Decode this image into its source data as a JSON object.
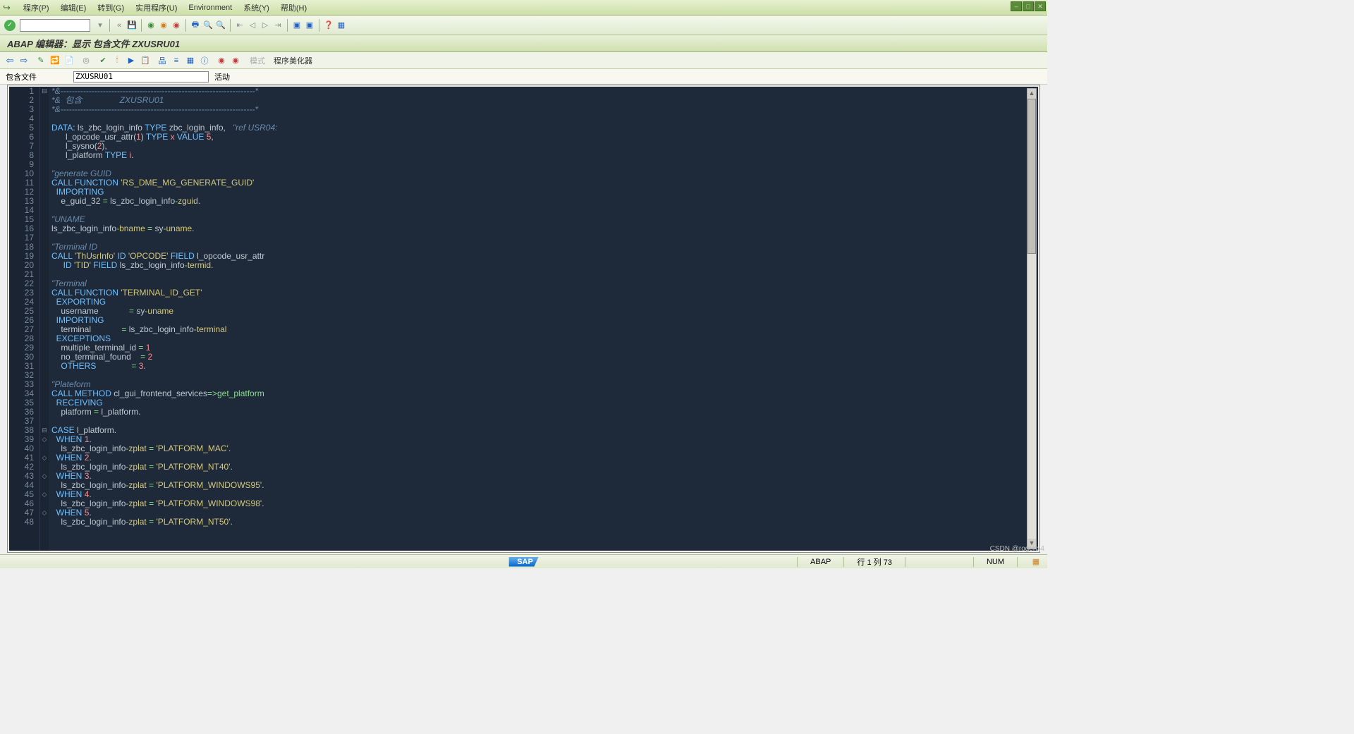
{
  "menubar": {
    "items": [
      "程序(P)",
      "编辑(E)",
      "转到(G)",
      "实用程序(U)",
      "Environment",
      "系统(Y)",
      "帮助(H)"
    ]
  },
  "title": "ABAP 编辑器：显示 包含文件 ZXUSRU01",
  "subtoolbar": {
    "mode_label": "模式",
    "beautify_label": "程序美化器"
  },
  "include": {
    "label": "包含文件",
    "value": "ZXUSRU01",
    "status": "活动"
  },
  "editor": {
    "line_count": 48,
    "fold_markers": {
      "1": "⊟",
      "38": "⊟",
      "39": "◇",
      "41": "◇",
      "43": "◇",
      "45": "◇",
      "47": "◇"
    },
    "lines": [
      [
        [
          "c-comment",
          "*&---------------------------------------------------------------------*"
        ]
      ],
      [
        [
          "c-comment",
          "*&  包含                ZXUSRU01"
        ]
      ],
      [
        [
          "c-comment",
          "*&---------------------------------------------------------------------*"
        ]
      ],
      [],
      [
        [
          "c-key",
          "DATA"
        ],
        [
          "c-plain",
          ": ls_zbc_login_info "
        ],
        [
          "c-key",
          "TYPE"
        ],
        [
          "c-plain",
          " zbc_login_info,   "
        ],
        [
          "c-comment",
          "\"ref USR04:"
        ]
      ],
      [
        [
          "c-plain",
          "      l_opcode_usr_attr("
        ],
        [
          "c-num",
          "1"
        ],
        [
          "c-plain",
          ") "
        ],
        [
          "c-key",
          "TYPE"
        ],
        [
          "c-plain",
          " "
        ],
        [
          "c-type",
          "x"
        ],
        [
          "c-plain",
          " "
        ],
        [
          "c-key",
          "VALUE"
        ],
        [
          "c-plain",
          " "
        ],
        [
          "c-num",
          "5"
        ],
        [
          "c-plain",
          ","
        ]
      ],
      [
        [
          "c-plain",
          "      l_sysno("
        ],
        [
          "c-num",
          "2"
        ],
        [
          "c-plain",
          "),"
        ]
      ],
      [
        [
          "c-plain",
          "      l_platform "
        ],
        [
          "c-key",
          "TYPE"
        ],
        [
          "c-plain",
          " "
        ],
        [
          "c-type",
          "i"
        ],
        [
          "c-plain",
          "."
        ]
      ],
      [],
      [
        [
          "c-comment",
          "\"generate GUID"
        ]
      ],
      [
        [
          "c-key",
          "CALL FUNCTION"
        ],
        [
          "c-plain",
          " "
        ],
        [
          "c-str",
          "'RS_DME_MG_GENERATE_GUID'"
        ]
      ],
      [
        [
          "c-plain",
          "  "
        ],
        [
          "c-key",
          "IMPORTING"
        ]
      ],
      [
        [
          "c-plain",
          "    e_guid_32 "
        ],
        [
          "c-op",
          "="
        ],
        [
          "c-plain",
          " ls_zbc_login_info"
        ],
        [
          "c-op",
          "-"
        ],
        [
          "c-field",
          "zguid"
        ],
        [
          "c-plain",
          "."
        ]
      ],
      [],
      [
        [
          "c-comment",
          "\"UNAME"
        ]
      ],
      [
        [
          "c-plain",
          "ls_zbc_login_info"
        ],
        [
          "c-op",
          "-"
        ],
        [
          "c-field",
          "bname"
        ],
        [
          "c-plain",
          " "
        ],
        [
          "c-op",
          "="
        ],
        [
          "c-plain",
          " sy"
        ],
        [
          "c-op",
          "-"
        ],
        [
          "c-field",
          "uname"
        ],
        [
          "c-plain",
          "."
        ]
      ],
      [],
      [
        [
          "c-comment",
          "\"Terminal ID"
        ]
      ],
      [
        [
          "c-key",
          "CALL"
        ],
        [
          "c-plain",
          " "
        ],
        [
          "c-str",
          "'ThUsrInfo'"
        ],
        [
          "c-plain",
          " "
        ],
        [
          "c-key",
          "ID"
        ],
        [
          "c-plain",
          " "
        ],
        [
          "c-str",
          "'OPCODE'"
        ],
        [
          "c-plain",
          " "
        ],
        [
          "c-key",
          "FIELD"
        ],
        [
          "c-plain",
          " l_opcode_usr_attr"
        ]
      ],
      [
        [
          "c-plain",
          "     "
        ],
        [
          "c-key",
          "ID"
        ],
        [
          "c-plain",
          " "
        ],
        [
          "c-str",
          "'TID'"
        ],
        [
          "c-plain",
          " "
        ],
        [
          "c-key",
          "FIELD"
        ],
        [
          "c-plain",
          " ls_zbc_login_info"
        ],
        [
          "c-op",
          "-"
        ],
        [
          "c-field",
          "termid"
        ],
        [
          "c-plain",
          "."
        ]
      ],
      [],
      [
        [
          "c-comment",
          "\"Terminal"
        ]
      ],
      [
        [
          "c-key",
          "CALL FUNCTION"
        ],
        [
          "c-plain",
          " "
        ],
        [
          "c-str",
          "'TERMINAL_ID_GET'"
        ]
      ],
      [
        [
          "c-plain",
          "  "
        ],
        [
          "c-key",
          "EXPORTING"
        ]
      ],
      [
        [
          "c-plain",
          "    username             "
        ],
        [
          "c-op",
          "="
        ],
        [
          "c-plain",
          " sy"
        ],
        [
          "c-op",
          "-"
        ],
        [
          "c-field",
          "uname"
        ]
      ],
      [
        [
          "c-plain",
          "  "
        ],
        [
          "c-key",
          "IMPORTING"
        ]
      ],
      [
        [
          "c-plain",
          "    terminal             "
        ],
        [
          "c-op",
          "="
        ],
        [
          "c-plain",
          " ls_zbc_login_info"
        ],
        [
          "c-op",
          "-"
        ],
        [
          "c-field",
          "terminal"
        ]
      ],
      [
        [
          "c-plain",
          "  "
        ],
        [
          "c-key",
          "EXCEPTIONS"
        ]
      ],
      [
        [
          "c-plain",
          "    multiple_terminal_id "
        ],
        [
          "c-op",
          "="
        ],
        [
          "c-plain",
          " "
        ],
        [
          "c-num",
          "1"
        ]
      ],
      [
        [
          "c-plain",
          "    no_terminal_found    "
        ],
        [
          "c-op",
          "="
        ],
        [
          "c-plain",
          " "
        ],
        [
          "c-num",
          "2"
        ]
      ],
      [
        [
          "c-plain",
          "    "
        ],
        [
          "c-key",
          "OTHERS"
        ],
        [
          "c-plain",
          "               "
        ],
        [
          "c-op",
          "="
        ],
        [
          "c-plain",
          " "
        ],
        [
          "c-num",
          "3"
        ],
        [
          "c-plain",
          "."
        ]
      ],
      [],
      [
        [
          "c-comment",
          "\"Plateform"
        ]
      ],
      [
        [
          "c-key",
          "CALL METHOD"
        ],
        [
          "c-plain",
          " cl_gui_frontend_services"
        ],
        [
          "c-op",
          "=>"
        ],
        [
          "c-func",
          "get_platform"
        ]
      ],
      [
        [
          "c-plain",
          "  "
        ],
        [
          "c-key",
          "RECEIVING"
        ]
      ],
      [
        [
          "c-plain",
          "    platform "
        ],
        [
          "c-op",
          "="
        ],
        [
          "c-plain",
          " l_platform."
        ]
      ],
      [],
      [
        [
          "c-key",
          "CASE"
        ],
        [
          "c-plain",
          " l_platform."
        ]
      ],
      [
        [
          "c-plain",
          "  "
        ],
        [
          "c-key",
          "WHEN"
        ],
        [
          "c-plain",
          " "
        ],
        [
          "c-num",
          "1"
        ],
        [
          "c-plain",
          "."
        ]
      ],
      [
        [
          "c-plain",
          "    ls_zbc_login_info"
        ],
        [
          "c-op",
          "-"
        ],
        [
          "c-field",
          "zplat"
        ],
        [
          "c-plain",
          " "
        ],
        [
          "c-op",
          "="
        ],
        [
          "c-plain",
          " "
        ],
        [
          "c-str",
          "'PLATFORM_MAC'"
        ],
        [
          "c-plain",
          "."
        ]
      ],
      [
        [
          "c-plain",
          "  "
        ],
        [
          "c-key",
          "WHEN"
        ],
        [
          "c-plain",
          " "
        ],
        [
          "c-num",
          "2"
        ],
        [
          "c-plain",
          "."
        ]
      ],
      [
        [
          "c-plain",
          "    ls_zbc_login_info"
        ],
        [
          "c-op",
          "-"
        ],
        [
          "c-field",
          "zplat"
        ],
        [
          "c-plain",
          " "
        ],
        [
          "c-op",
          "="
        ],
        [
          "c-plain",
          " "
        ],
        [
          "c-str",
          "'PLATFORM_NT40'"
        ],
        [
          "c-plain",
          "."
        ]
      ],
      [
        [
          "c-plain",
          "  "
        ],
        [
          "c-key",
          "WHEN"
        ],
        [
          "c-plain",
          " "
        ],
        [
          "c-num",
          "3"
        ],
        [
          "c-plain",
          "."
        ]
      ],
      [
        [
          "c-plain",
          "    ls_zbc_login_info"
        ],
        [
          "c-op",
          "-"
        ],
        [
          "c-field",
          "zplat"
        ],
        [
          "c-plain",
          " "
        ],
        [
          "c-op",
          "="
        ],
        [
          "c-plain",
          " "
        ],
        [
          "c-str",
          "'PLATFORM_WINDOWS95'"
        ],
        [
          "c-plain",
          "."
        ]
      ],
      [
        [
          "c-plain",
          "  "
        ],
        [
          "c-key",
          "WHEN"
        ],
        [
          "c-plain",
          " "
        ],
        [
          "c-num",
          "4"
        ],
        [
          "c-plain",
          "."
        ]
      ],
      [
        [
          "c-plain",
          "    ls_zbc_login_info"
        ],
        [
          "c-op",
          "-"
        ],
        [
          "c-field",
          "zplat"
        ],
        [
          "c-plain",
          " "
        ],
        [
          "c-op",
          "="
        ],
        [
          "c-plain",
          " "
        ],
        [
          "c-str",
          "'PLATFORM_WINDOWS98'"
        ],
        [
          "c-plain",
          "."
        ]
      ],
      [
        [
          "c-plain",
          "  "
        ],
        [
          "c-key",
          "WHEN"
        ],
        [
          "c-plain",
          " "
        ],
        [
          "c-num",
          "5"
        ],
        [
          "c-plain",
          "."
        ]
      ],
      [
        [
          "c-plain",
          "    ls_zbc_login_info"
        ],
        [
          "c-op",
          "-"
        ],
        [
          "c-field",
          "zplat"
        ],
        [
          "c-plain",
          " "
        ],
        [
          "c-op",
          "="
        ],
        [
          "c-plain",
          " "
        ],
        [
          "c-str",
          "'PLATFORM_NT50'"
        ],
        [
          "c-plain",
          "."
        ]
      ]
    ]
  },
  "statusbar": {
    "sap": "SAP",
    "lang": "ABAP",
    "pos": "行 1 列 73",
    "num": "NUM",
    "watermark": "CSDN @rogerix4"
  }
}
